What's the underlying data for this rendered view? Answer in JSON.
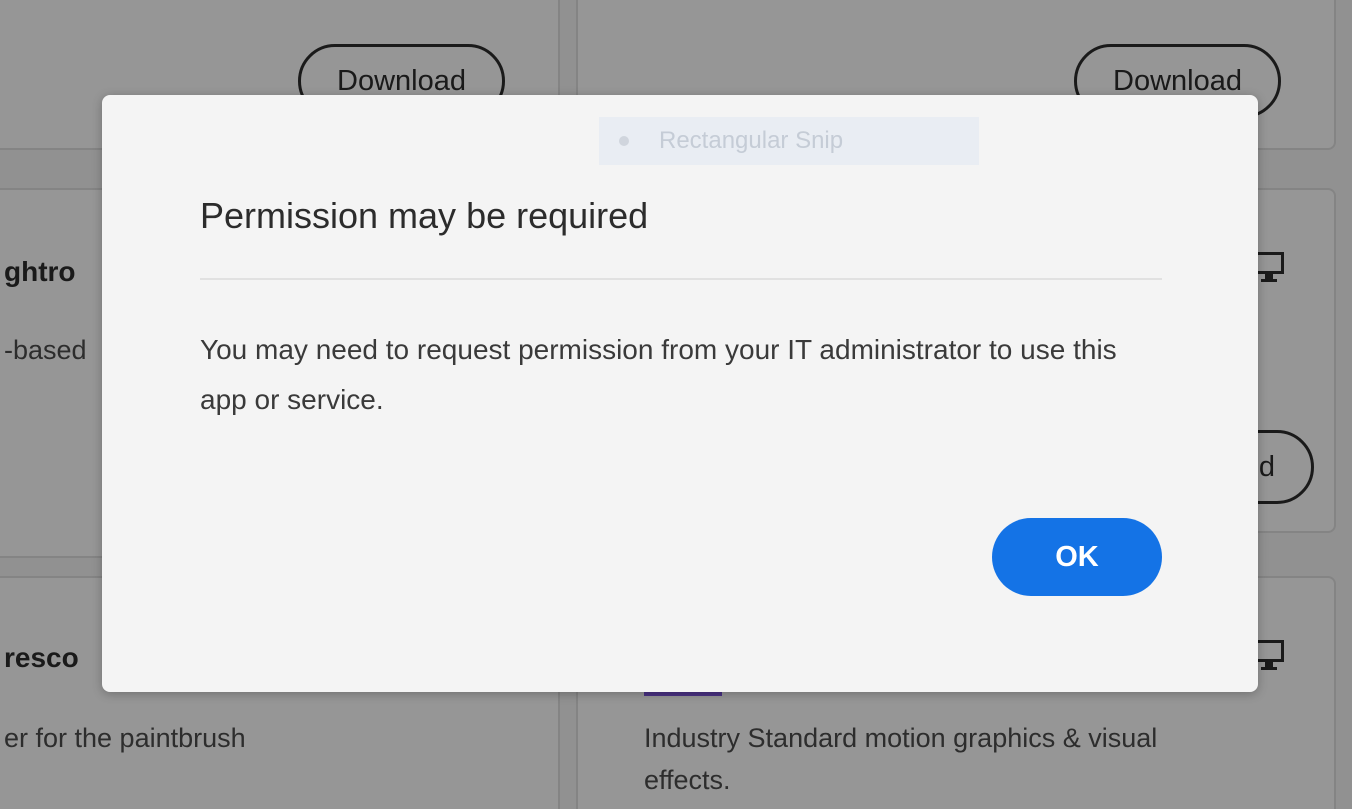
{
  "background": {
    "cards": [
      {
        "download_label": "Download",
        "app_name": "ghtro",
        "desc": "-based"
      },
      {
        "download_label": "Download"
      },
      {
        "download_label": "d"
      },
      {
        "app_name": "resco",
        "desc": "er for the paintbrush"
      },
      {
        "desc_line1": "Industry Standard motion graphics & visual",
        "desc_line2": "effects."
      }
    ],
    "icons": [
      "desktop-icon",
      "desktop-icon"
    ]
  },
  "snip_overlay": {
    "label": "Rectangular Snip"
  },
  "dialog": {
    "title": "Permission may be required",
    "body": "You may need to request permission from your IT administrator to use this app or service.",
    "ok_label": "OK"
  },
  "colors": {
    "accent": "#1473e6",
    "scrim": "rgba(0,0,0,0.40)",
    "dialog_bg": "#f4f4f4"
  }
}
